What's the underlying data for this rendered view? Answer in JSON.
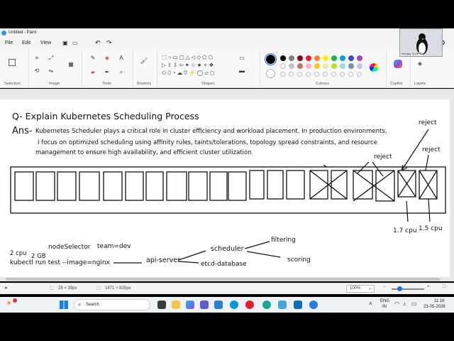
{
  "window": {
    "title": "Untitled - Paint"
  },
  "menu": {
    "file": "File",
    "edit": "Edit",
    "view": "View"
  },
  "ribbon": {
    "selection": "Selection",
    "image": "Image",
    "tools": "Tools",
    "brushes": "Brushes",
    "shapes": "Shapes",
    "colours": "Colours",
    "copilot": "Copilot",
    "layers": "Layers"
  },
  "palette": [
    "#000000",
    "#7f7f7f",
    "#880015",
    "#ed1c24",
    "#ff7f27",
    "#fff200",
    "#22b14c",
    "#00a2e8",
    "#3f48cc",
    "#a349a4",
    "#ffffff",
    "#c3c3c3",
    "#b97a57",
    "#ffaec9",
    "#ffc90e",
    "#efe4b0",
    "#b5e61d",
    "#99d9ea",
    "#7092be",
    "#c8bfe7"
  ],
  "webcam": {
    "name": "Sanjay GUPTA"
  },
  "canvas": {
    "question": "Q- Explain Kubernetes Scheduling Process",
    "ans_prefix": "Ans-",
    "answer_line1": "Kubernetes Scheduler plays a critical role in cluster efficiency and workload placement. In production environments,",
    "answer_line2": "I focus on optimized scheduling using affinity rules, taints/tolerations, topology spread constraints, and resource",
    "answer_line3": "management to ensure high availability, and efficient cluster utilization",
    "reject1": "reject",
    "reject2": "reject",
    "reject3": "reject",
    "cpu1": "1.7 cpu",
    "cpu2": "1.5 cpu",
    "node_selector": "nodeSelector",
    "team": "team=dev",
    "mem_cpu": "2 cpu",
    "mem_gb": "2 GB",
    "kubectl": "kubectl run test --image=nginx",
    "api_server": "api-server",
    "scheduler": "scheduler",
    "filtering": "filtering",
    "scoring": "scoring",
    "etcd": "etcd-database"
  },
  "status": {
    "cursor_size": "28 × 39px",
    "canvas_size": "1871 × 835px",
    "zoom": "100%"
  },
  "taskbar": {
    "search_placeholder": "Search",
    "lang": "ENG",
    "lang2": "IN",
    "time": "11:16",
    "date": "23-05-2026"
  }
}
